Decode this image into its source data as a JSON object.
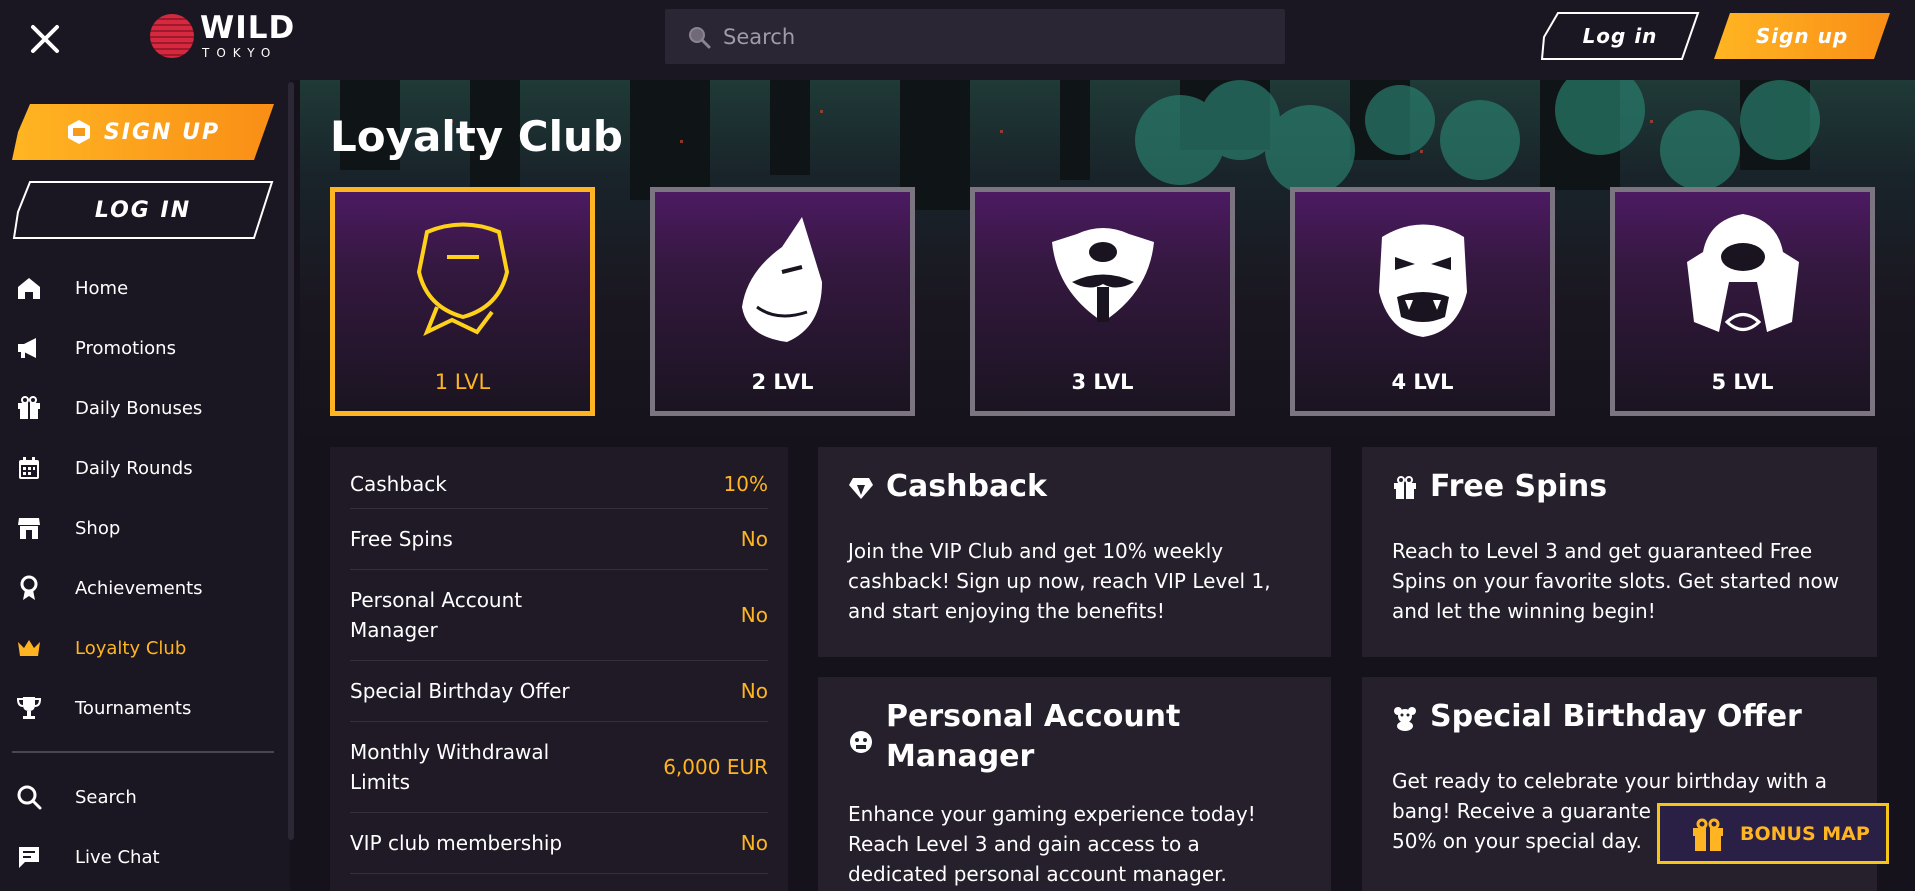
{
  "topbar": {
    "logo_word": "WILD",
    "logo_sub": "TOKYO",
    "search_placeholder": "Search",
    "login_label": "Log in",
    "signup_label": "Sign up"
  },
  "sidebar": {
    "signup_label": "SIGN UP",
    "login_label": "LOG IN",
    "items": [
      {
        "label": "Home",
        "icon": "home-icon"
      },
      {
        "label": "Promotions",
        "icon": "megaphone-icon"
      },
      {
        "label": "Daily Bonuses",
        "icon": "gift-icon"
      },
      {
        "label": "Daily Rounds",
        "icon": "calendar-icon"
      },
      {
        "label": "Shop",
        "icon": "shop-icon"
      },
      {
        "label": "Achievements",
        "icon": "ribbon-icon"
      },
      {
        "label": "Loyalty Club",
        "icon": "crown-icon",
        "active": true
      },
      {
        "label": "Tournaments",
        "icon": "trophy-icon"
      }
    ],
    "secondary": [
      {
        "label": "Search",
        "icon": "search-icon"
      },
      {
        "label": "Live Chat",
        "icon": "chat-icon"
      }
    ]
  },
  "main": {
    "title": "Loyalty Club",
    "levels": [
      {
        "label": "1 LVL",
        "icon": "bandana-mask-icon",
        "active": true
      },
      {
        "label": "2 LVL",
        "icon": "kitsune-mask-icon"
      },
      {
        "label": "3 LVL",
        "icon": "mustache-mask-icon"
      },
      {
        "label": "4 LVL",
        "icon": "oni-mask-icon"
      },
      {
        "label": "5 LVL",
        "icon": "samurai-helmet-icon"
      }
    ],
    "benefits": [
      {
        "name": "Cashback",
        "value": "10%"
      },
      {
        "name": "Free Spins",
        "value": "No"
      },
      {
        "name": "Personal Account Manager",
        "value": "No"
      },
      {
        "name": "Special Birthday Offer",
        "value": "No"
      },
      {
        "name": "Monthly Withdrawal Limits",
        "value": "6,000 EUR"
      },
      {
        "name": "VIP club membership",
        "value": "No"
      }
    ],
    "cards": [
      {
        "title": "Cashback",
        "icon": "diamond-icon",
        "text": [
          "Join the VIP Club and get 10% weekly",
          "cashback! Sign up now, reach VIP Level 1,",
          "and start enjoying the benefits!"
        ]
      },
      {
        "title": "Free Spins",
        "icon": "gift-icon",
        "text": [
          "Reach to Level 3 and get guaranteed Free",
          "Spins on your favorite slots. Get started now",
          "and let the winning begin!"
        ]
      },
      {
        "title": "Personal Account Manager",
        "title_lines": [
          "Personal Account",
          "Manager"
        ],
        "icon": "manager-icon",
        "text": [
          "Enhance your gaming experience today!",
          "Reach Level 3 and gain access to a",
          "dedicated personal account manager."
        ]
      },
      {
        "title": "Special Birthday Offer",
        "icon": "teddy-bear-icon",
        "text": [
          "Get ready to celebrate your birthday with a",
          "bang! Receive a guarante",
          "50% on your special day."
        ]
      }
    ]
  },
  "bonus_map": {
    "label": "BONUS MAP"
  },
  "colors": {
    "accent": "#ffb522",
    "bg": "#15121b",
    "panel": "#1f1a26"
  }
}
